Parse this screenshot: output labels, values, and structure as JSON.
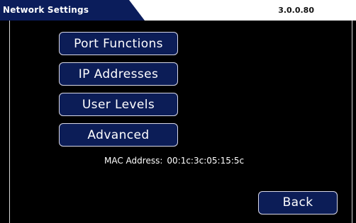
{
  "header": {
    "title": "Network Settings",
    "version": "3.0.0.80"
  },
  "menu": {
    "items": [
      {
        "label": "Port Functions"
      },
      {
        "label": "IP Addresses"
      },
      {
        "label": "User Levels"
      },
      {
        "label": "Advanced"
      }
    ]
  },
  "info": {
    "mac_label": "MAC Address:",
    "mac_value": "00:1c:3c:05:15:5c"
  },
  "footer": {
    "back_label": "Back"
  },
  "colors": {
    "tab_bg": "#0b1d5b",
    "button_bg": "#0c1d57",
    "button_border": "#d8d8e8",
    "screen_bg": "#000000"
  }
}
